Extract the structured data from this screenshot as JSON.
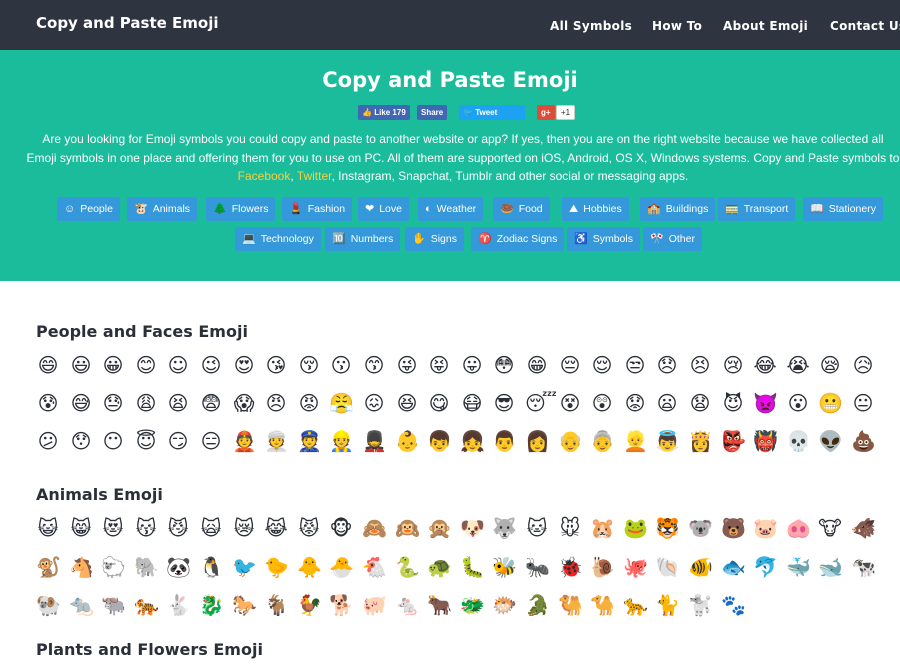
{
  "nav": {
    "brand": "Copy and Paste Emoji",
    "links": [
      "All Symbols",
      "How To",
      "About Emoji",
      "Contact Us"
    ]
  },
  "hero": {
    "title": "Copy and Paste Emoji",
    "social": {
      "like_label": "Like 179",
      "share_label": "Share",
      "tweet_label": "Tweet",
      "gplus_label": "g+",
      "gplus_count": "+1"
    },
    "text_part1": "Are you looking for Emoji symbols you could copy and paste to another website or app? If yes, then you are on the right website because we have collected all Emoji symbols in one place and offering them for you to use on PC. All of them are supported on iOS, Android, OS X, Windows systems. Copy and Paste symbols to ",
    "link_facebook": "Facebook",
    "sep": ", ",
    "link_twitter": "Twitter",
    "text_part2": ", Instagram, Snapchat, Tumblr and other social or messaging apps.",
    "categories_row1": [
      {
        "icon": "☺",
        "label": "People"
      },
      {
        "icon": "🐮",
        "label": "Animals"
      },
      {
        "icon": "🌲",
        "label": "Flowers"
      },
      {
        "icon": "💄",
        "label": "Fashion"
      },
      {
        "icon": "❤",
        "label": "Love"
      },
      {
        "icon": "◐",
        "label": "Weather"
      },
      {
        "icon": "🍩",
        "label": "Food"
      },
      {
        "icon": "⛰",
        "label": "Hobbies"
      },
      {
        "icon": "🏫",
        "label": "Buildings"
      },
      {
        "icon": "🚃",
        "label": "Transport"
      },
      {
        "icon": "📖",
        "label": "Stationery"
      }
    ],
    "categories_row2": [
      {
        "icon": "💻",
        "label": "Technology"
      },
      {
        "icon": "🔟",
        "label": "Numbers"
      },
      {
        "icon": "✋",
        "label": "Signs"
      },
      {
        "icon": "♈",
        "label": "Zodiac Signs"
      },
      {
        "icon": "♿",
        "label": "Symbols"
      },
      {
        "icon": "🎌",
        "label": "Other"
      }
    ]
  },
  "sections": [
    {
      "title": "People and Faces Emoji",
      "rows": [
        [
          "😄",
          "😃",
          "😀",
          "😊",
          "☺",
          "😉",
          "😍",
          "😘",
          "😚",
          "😗",
          "😙",
          "😜",
          "😝",
          "😛",
          "😳",
          "😁",
          "😔",
          "😌",
          "😒",
          "😞",
          "😣",
          "😢",
          "😂",
          "😭",
          "😪",
          "😥"
        ],
        [
          "😰",
          "😅",
          "😓",
          "😩",
          "😫",
          "😨",
          "😱",
          "😠",
          "😡",
          "😤",
          "😖",
          "😆",
          "😋",
          "😷",
          "😎",
          "😴",
          "😵",
          "😲",
          "😟",
          "😦",
          "😧",
          "😈",
          "👿",
          "😮",
          "😬",
          "😐"
        ],
        [
          "😕",
          "😯",
          "😶",
          "😇",
          "😏",
          "😑",
          "👲",
          "👳",
          "👮",
          "👷",
          "💂",
          "👶",
          "👦",
          "👧",
          "👨",
          "👩",
          "👴",
          "👵",
          "👱",
          "👼",
          "👸",
          "👺",
          "👹",
          "💀",
          "👽",
          "💩"
        ]
      ]
    },
    {
      "title": "Animals Emoji",
      "rows": [
        [
          "😺",
          "😸",
          "😻",
          "😽",
          "😼",
          "🙀",
          "😿",
          "😹",
          "😾",
          "🐵",
          "🙈",
          "🙉",
          "🙊",
          "🐶",
          "🐺",
          "🐱",
          "🐭",
          "🐹",
          "🐸",
          "🐯",
          "🐨",
          "🐻",
          "🐷",
          "🐽",
          "🐮",
          "🐗"
        ],
        [
          "🐒",
          "🐴",
          "🐑",
          "🐘",
          "🐼",
          "🐧",
          "🐦",
          "🐤",
          "🐥",
          "🐣",
          "🐔",
          "🐍",
          "🐢",
          "🐛",
          "🐝",
          "🐜",
          "🐞",
          "🐌",
          "🐙",
          "🐚",
          "🐠",
          "🐟",
          "🐬",
          "🐳",
          "🐋",
          "🐄"
        ],
        [
          "🐏",
          "🐀",
          "🐃",
          "🐅",
          "🐇",
          "🐉",
          "🐎",
          "🐐",
          "🐓",
          "🐕",
          "🐖",
          "🐁",
          "🐂",
          "🐲",
          "🐡",
          "🐊",
          "🐫",
          "🐪",
          "🐆",
          "🐈",
          "🐩",
          "🐾"
        ]
      ]
    },
    {
      "title": "Plants and Flowers Emoji",
      "rows": []
    }
  ]
}
